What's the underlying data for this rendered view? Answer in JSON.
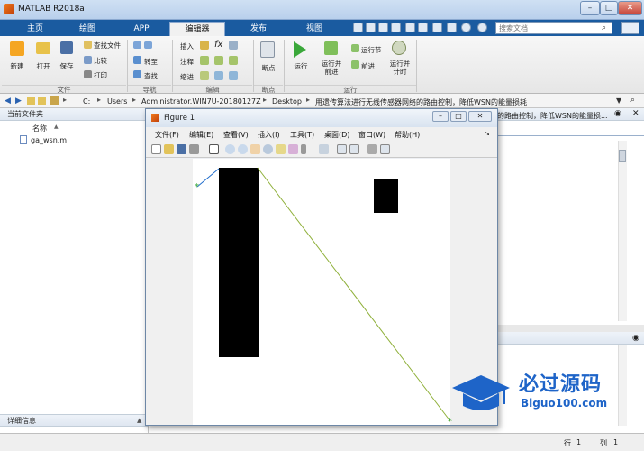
{
  "window": {
    "title": "MATLAB R2018a"
  },
  "tabs": [
    {
      "label": "主页"
    },
    {
      "label": "绘图"
    },
    {
      "label": "APP"
    },
    {
      "label": "编辑器"
    },
    {
      "label": "发布"
    },
    {
      "label": "视图"
    }
  ],
  "search": {
    "placeholder": "搜索文档"
  },
  "ribbon": {
    "file": {
      "new": "新建",
      "open": "打开",
      "save": "保存",
      "find_files": "查找文件",
      "compare": "比较",
      "print": "打印",
      "group": "文件"
    },
    "navigate": {
      "goto": "转至",
      "find": "查找",
      "group": "导航"
    },
    "edit": {
      "insert": "插入",
      "comment": "注释",
      "indent": "缩进",
      "fx": "fx",
      "group": "编辑"
    },
    "breakpoints": {
      "label": "断点",
      "group": "断点"
    },
    "run": {
      "run": "运行",
      "run_advance": "运行并\n前进",
      "run_section": "运行节",
      "advance": "前进",
      "run_time": "运行并\n计时",
      "group": "运行"
    }
  },
  "address": {
    "segments": [
      "C:",
      "Users",
      "Administrator.WIN7U-20180127Z",
      "Desktop",
      "用遗传算法进行无线传感器网络的路由控制，降低WSN的能量损耗"
    ]
  },
  "left_panel": {
    "header": "当前文件夹",
    "col_name": "名称",
    "col_sort": "▲",
    "files": [
      {
        "name": "ga_wsn.m"
      }
    ],
    "details": "详细信息"
  },
  "right_panel": {
    "header_text": "的路由控制，降低WSN的能量损..."
  },
  "statusbar": {
    "row_label": "行",
    "row": "1",
    "col_label": "列",
    "col": "1"
  },
  "figure": {
    "title": "Figure 1",
    "menu": [
      "文件(F)",
      "编辑(E)",
      "查看(V)",
      "插入(I)",
      "工具(T)",
      "桌面(D)",
      "窗口(W)",
      "帮助(H)"
    ]
  },
  "watermark": {
    "brand": "必过源码",
    "url": "Biguo100.com"
  },
  "colors": {
    "tab_strip": "#1a5ba0",
    "line": "#8fb03a",
    "segment": "#1f6ccc",
    "bars": "#000000"
  }
}
